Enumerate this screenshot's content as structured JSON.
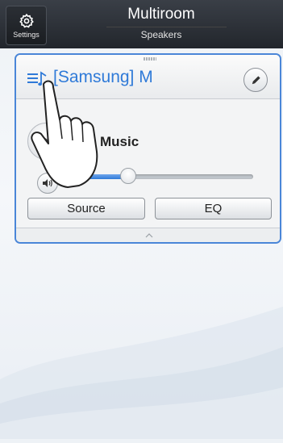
{
  "header": {
    "settings_label": "Settings",
    "title": "Multiroom",
    "subtitle": "Speakers"
  },
  "speaker_card": {
    "device_name": "[Samsung] M",
    "track_title": "Music",
    "volume_level": 0.27,
    "source_label": "Source",
    "eq_label": "EQ"
  },
  "colors": {
    "accent": "#2f7ad8",
    "header_bg": "#22262c"
  },
  "icons": {
    "settings": "gear-icon",
    "playlist": "playlist-icon",
    "edit": "pencil-icon",
    "play": "play-icon",
    "volume": "speaker-icon",
    "collapse": "chevron-up-icon",
    "pointer": "hand-pointer-icon"
  }
}
